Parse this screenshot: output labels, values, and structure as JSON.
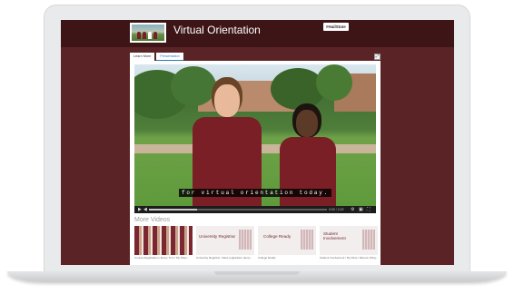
{
  "header": {
    "title": "Virtual Orientation",
    "tag": "#HailState"
  },
  "tabs": [
    {
      "label": "Learn More"
    },
    {
      "label": "Presentation"
    }
  ],
  "video": {
    "caption": "for virtual orientation today.",
    "progress": 0.27,
    "time": "0:00 / 2:22"
  },
  "more_videos": {
    "heading": "More Videos",
    "items": [
      {
        "title": "Course Registration / Every Turn / My Pass...",
        "card_text": ""
      },
      {
        "title": "University Registrar: Class registration demo...",
        "card_text": "University Registrar"
      },
      {
        "title": "College Ready",
        "card_text": "College Ready"
      },
      {
        "title": "Student Involvement / My Pass / Maroon Wing...",
        "card_text": "Student Involvement"
      }
    ]
  },
  "colors": {
    "maroon": "#5a2326",
    "header_maroon": "#3e1517",
    "link_blue": "#2a7ab8"
  }
}
